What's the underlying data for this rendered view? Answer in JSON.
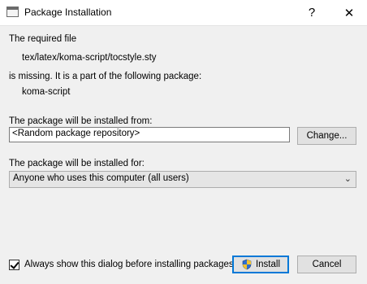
{
  "window": {
    "title": "Package Installation",
    "help_glyph": "?",
    "close_glyph": "✕"
  },
  "message": {
    "line1": "The required file",
    "file_path": "tex/latex/koma-script/tocstyle.sty",
    "line2": "is missing. It is a part of the following package:",
    "package": "koma-script"
  },
  "source": {
    "label": "The package will be installed from:",
    "value": "<Random package repository>",
    "change_label": "Change..."
  },
  "target": {
    "label": "The package will be installed for:",
    "selected": "Anyone who uses this computer (all users)",
    "chevron": "⌄"
  },
  "footer": {
    "checkbox_label": "Always show this dialog before installing packages",
    "checkbox_checked": true,
    "install_label": "Install",
    "cancel_label": "Cancel"
  },
  "colors": {
    "focus_border": "#0078d7",
    "client_bg": "#f0f0f0"
  }
}
